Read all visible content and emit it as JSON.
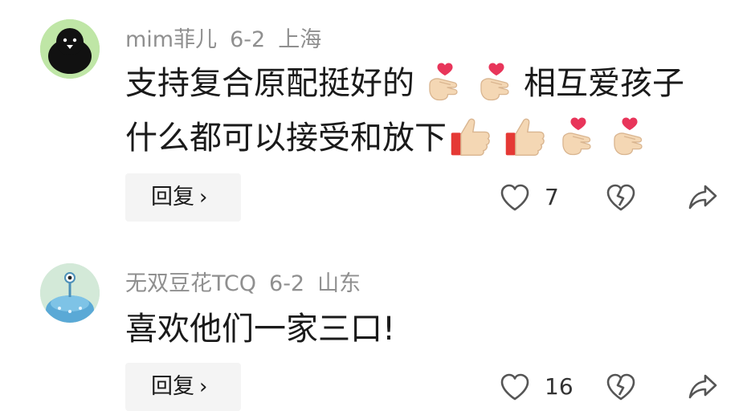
{
  "comments": [
    {
      "avatar_icon": "black-penguin-avatar-icon",
      "username": "mim菲儿",
      "date": "6-2",
      "location": "上海",
      "text_line_1": "支持复合原配挺好的",
      "text_line_1_suffix": "相互爱孩子",
      "text_line_2": "什么都可以接受和放下",
      "emojis_line_1": [
        "finger-heart-icon",
        "finger-heart-icon"
      ],
      "emojis_line_2": [
        "thumbs-up-icon",
        "thumbs-up-icon",
        "finger-heart-icon",
        "finger-heart-icon"
      ],
      "reply_label": "回复",
      "like_count": "7"
    },
    {
      "avatar_icon": "blue-cartoon-avatar-icon",
      "username": "无双豆花TCQ",
      "date": "6-2",
      "location": "山东",
      "text_line_1": "喜欢他们一家三口!",
      "reply_label": "回复",
      "like_count": "16"
    }
  ],
  "icons": {
    "like": "heart-outline-icon",
    "dislike": "broken-heart-icon",
    "share": "share-arrow-icon",
    "reply_chevron": "chevron-right-icon"
  },
  "colors": {
    "meta_text": "#8f8f8f",
    "reply_bg": "#f4f4f4",
    "heart": "#e8355a",
    "hand_skin": "#f4d7b4"
  }
}
